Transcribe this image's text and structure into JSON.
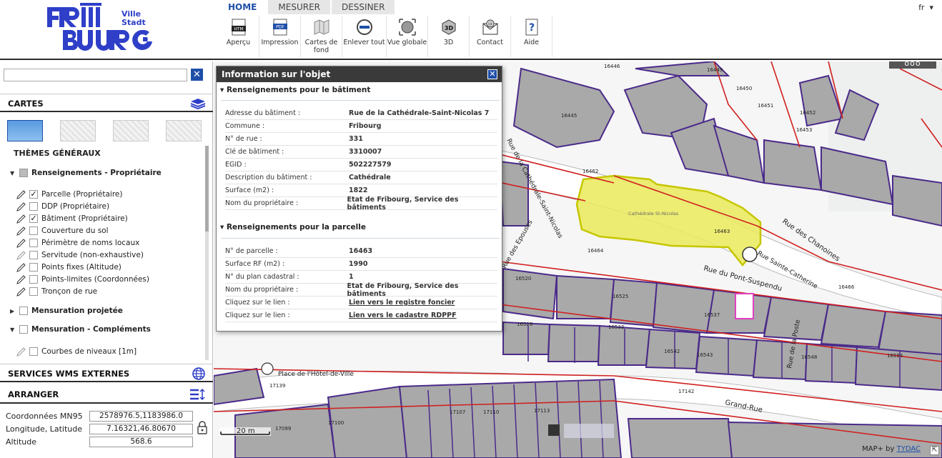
{
  "logo": {
    "line1": "FRıBI",
    "line2": "BOURG",
    "small1": "Ville",
    "small2": "Stadt"
  },
  "tabs": [
    {
      "label": "HOME",
      "active": true
    },
    {
      "label": "MESURER",
      "active": false
    },
    {
      "label": "DESSINER",
      "active": false
    }
  ],
  "toolbar": [
    {
      "label": "Aperçu",
      "icon": "html-icon"
    },
    {
      "label": "Impression",
      "icon": "pdf-icon"
    },
    {
      "label": "Cartes de fond",
      "icon": "map-folded-icon"
    },
    {
      "label": "Enlever tout",
      "icon": "eraser-icon"
    },
    {
      "label": "Vue globale",
      "icon": "globe-icon"
    },
    {
      "label": "3D",
      "icon": "cube-3d-icon"
    },
    {
      "label": "Contact",
      "icon": "mail-icon"
    },
    {
      "label": "Aide",
      "icon": "help-icon"
    }
  ],
  "lang": "fr",
  "left": {
    "search_placeholder": "",
    "cartes_label": "CARTES",
    "themes_label": "THÈMES GÉNÉRAUX",
    "groups": [
      {
        "label": "Renseignements - Propriétaire",
        "expanded": true
      },
      {
        "label": "Mensuration projetée",
        "expanded": false
      },
      {
        "label": "Mensuration - Compléments",
        "expanded": true
      }
    ],
    "layers": [
      {
        "label": "Parcelle (Propriétaire)",
        "checked": true
      },
      {
        "label": "DDP (Propriétaire)",
        "checked": false
      },
      {
        "label": "Bâtiment (Propriétaire)",
        "checked": true
      },
      {
        "label": "Couverture du sol",
        "checked": false
      },
      {
        "label": "Périmètre de noms locaux",
        "checked": false
      },
      {
        "label": "Servitude (non-exhaustive)",
        "checked": false
      },
      {
        "label": "Points fixes (Altitude)",
        "checked": false
      },
      {
        "label": "Points-limites (Coordonnées)",
        "checked": false
      },
      {
        "label": "Tronçon de rue",
        "checked": false
      }
    ],
    "extra_layer": {
      "label": "Courbes de niveaux [1m]",
      "checked": false
    },
    "wms_label": "SERVICES WMS EXTERNES",
    "arranger_label": "ARRANGER",
    "coords": [
      {
        "label": "Coordonnées MN95",
        "value": "2578976.5,1183986.0"
      },
      {
        "label": "Longitude, Latitude",
        "value": "7.16321,46.80670"
      },
      {
        "label": "Altitude",
        "value": "568.6"
      }
    ]
  },
  "map": {
    "menu": "ooo",
    "scale_label": "20 m",
    "attribution_prefix": "MAP+ by",
    "attribution_link": "TYDAC",
    "labels": {
      "cathedrale": "Cathédrale St-Nicolas",
      "p16463": "16463",
      "p16445": "16445",
      "p16446": "16446",
      "p16449": "16449",
      "p16450": "16450",
      "p16451": "16451",
      "p16452": "16452",
      "p16453": "16453",
      "p16462": "16462",
      "p16464": "16464",
      "p16466": "16466",
      "p16520": "16520",
      "p16525": "16525",
      "p16528": "16528",
      "p16529": "16529",
      "p16533": "16533",
      "p16537": "16537",
      "p16542": "16542",
      "p16543": "16543",
      "p16548": "16548",
      "p16554": "16554",
      "p17099": "17099",
      "p17100": "17100",
      "p17107": "17107",
      "p17110": "17110",
      "p17113": "17113",
      "p17139": "17139",
      "p17142": "17142",
      "r_chanoines": "Rue des Chanoines",
      "r_pontsusp": "Rue du Pont-Suspendu",
      "r_catherine": "Rue Sainte-Catherine",
      "r_epouses": "Rue des Epouses",
      "r_cathedrale": "Rue de la Cathédrale-Saint-Nicolas",
      "r_grandrue": "Grand-Rue",
      "r_hotelville": "Place de l'Hôtel-de-Ville",
      "r_poste": "Rue de la Poste"
    }
  },
  "info": {
    "title": "Information sur l'objet",
    "building_section": "Renseignements pour le bâtiment",
    "building_rows": [
      {
        "k": "Adresse du bâtiment :",
        "v": "Rue de la Cathédrale-Saint-Nicolas 7"
      },
      {
        "k": "Commune :",
        "v": "Fribourg"
      },
      {
        "k": "N° de rue :",
        "v": "331"
      },
      {
        "k": "Clé de bâtiment :",
        "v": "3310007"
      },
      {
        "k": "EGID :",
        "v": "502227579"
      },
      {
        "k": "Description du bâtiment :",
        "v": "Cathédrale"
      },
      {
        "k": "Surface (m2) :",
        "v": "1822"
      },
      {
        "k": "Nom du propriétaire :",
        "v": "Etat de Fribourg, Service des bâtiments"
      }
    ],
    "parcel_section": "Renseignements pour la parcelle",
    "parcel_rows": [
      {
        "k": "N° de parcelle :",
        "v": "16463"
      },
      {
        "k": "Surface RF (m2) :",
        "v": "1990"
      },
      {
        "k": "N° du plan cadastral :",
        "v": "1"
      },
      {
        "k": "Nom du propriétaire :",
        "v": "Etat de Fribourg, Service des bâtiments"
      },
      {
        "k": "Cliquez sur le lien :",
        "v": "Lien vers le registre foncier"
      },
      {
        "k": "Cliquez sur le lien :",
        "v": "Lien vers le cadastre RDPPF"
      }
    ]
  }
}
